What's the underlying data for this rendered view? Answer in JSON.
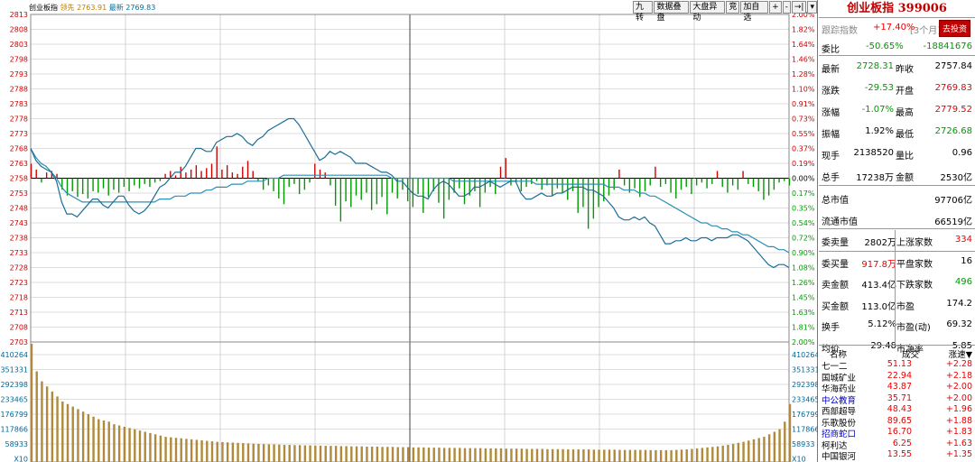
{
  "chart_info": {
    "name": "创业板指",
    "lead_label": "领先",
    "lead_value": "2763.91",
    "latest_label": "最新",
    "latest_value": "2769.83"
  },
  "toolbar": [
    "九转",
    "数据叠盘",
    "大盘异动",
    "竞",
    "加自选",
    "+",
    "-",
    "→|",
    "▾"
  ],
  "price_axis": [
    "2813",
    "2808",
    "2803",
    "2798",
    "2793",
    "2788",
    "2783",
    "2778",
    "2773",
    "2768",
    "2763",
    "2758",
    "2753",
    "2748",
    "2743",
    "2738",
    "2733",
    "2728",
    "2723",
    "2718",
    "2713",
    "2708",
    "2703"
  ],
  "pct_axis": [
    "2.00%",
    "1.82%",
    "1.64%",
    "1.46%",
    "1.28%",
    "1.10%",
    "0.91%",
    "0.73%",
    "0.55%",
    "0.37%",
    "0.19%",
    "0.00%",
    "0.17%",
    "0.35%",
    "0.54%",
    "0.72%",
    "0.90%",
    "1.08%",
    "1.26%",
    "1.45%",
    "1.63%",
    "1.81%",
    "2.00%"
  ],
  "volume_axis": [
    "410264",
    "351331",
    "292398",
    "233465",
    "176799",
    "117866",
    "58933",
    "X10"
  ],
  "chart_data": {
    "type": "line",
    "price_ylim": [
      2703,
      2813
    ],
    "prev_close": 2758,
    "volume_ylim": [
      0,
      469197
    ],
    "price_series": [
      2768,
      2764,
      2762,
      2761,
      2760,
      2757,
      2750,
      2746,
      2746,
      2745,
      2747,
      2749,
      2751,
      2751,
      2749,
      2748,
      2750,
      2752,
      2752,
      2749,
      2747,
      2746,
      2747,
      2749,
      2752,
      2755,
      2756,
      2758,
      2760,
      2760,
      2762,
      2765,
      2768,
      2768,
      2767,
      2767,
      2770,
      2771,
      2772,
      2772,
      2773,
      2772,
      2770,
      2769,
      2771,
      2772,
      2774,
      2775,
      2776,
      2777,
      2778,
      2778,
      2776,
      2773,
      2770,
      2767,
      2764,
      2765,
      2767,
      2766,
      2767,
      2766,
      2765,
      2763,
      2763,
      2763,
      2762,
      2761,
      2760,
      2760,
      2759,
      2757,
      2757,
      2755,
      2753,
      2752,
      2752,
      2751,
      2754,
      2756,
      2757,
      2756,
      2754,
      2752,
      2752,
      2753,
      2755,
      2755,
      2756,
      2757,
      2756,
      2755,
      2756,
      2757,
      2757,
      2753,
      2751,
      2751,
      2752,
      2753,
      2752,
      2752,
      2753,
      2753,
      2754,
      2755,
      2755,
      2755,
      2754,
      2754,
      2753,
      2752,
      2750,
      2748,
      2745,
      2744,
      2744,
      2745,
      2744,
      2745,
      2743,
      2742,
      2739,
      2736,
      2736,
      2737,
      2737,
      2738,
      2737,
      2737,
      2738,
      2738,
      2737,
      2738,
      2738,
      2738,
      2739,
      2739,
      2738,
      2737,
      2735,
      2733,
      2731,
      2729,
      2728,
      2729,
      2729,
      2728
    ],
    "avg_series": [
      2768,
      2765,
      2763,
      2762,
      2760,
      2758,
      2755,
      2753,
      2752,
      2751,
      2750,
      2750,
      2750,
      2750,
      2750,
      2750,
      2750,
      2750,
      2750,
      2750,
      2750,
      2750,
      2750,
      2750,
      2750,
      2751,
      2751,
      2751,
      2752,
      2752,
      2752,
      2753,
      2753,
      2753,
      2754,
      2754,
      2755,
      2755,
      2755,
      2756,
      2756,
      2756,
      2757,
      2757,
      2757,
      2757,
      2758,
      2758,
      2758,
      2759,
      2759,
      2759,
      2759,
      2759,
      2759,
      2759,
      2759,
      2759,
      2759,
      2759,
      2759,
      2759,
      2759,
      2759,
      2759,
      2759,
      2759,
      2759,
      2759,
      2759,
      2758,
      2758,
      2758,
      2758,
      2758,
      2758,
      2758,
      2758,
      2758,
      2758,
      2758,
      2758,
      2757,
      2757,
      2757,
      2757,
      2757,
      2757,
      2757,
      2757,
      2757,
      2757,
      2757,
      2757,
      2757,
      2757,
      2757,
      2757,
      2756,
      2756,
      2756,
      2756,
      2756,
      2756,
      2756,
      2756,
      2756,
      2756,
      2756,
      2756,
      2756,
      2756,
      2755,
      2755,
      2755,
      2754,
      2754,
      2754,
      2753,
      2753,
      2752,
      2752,
      2751,
      2750,
      2749,
      2748,
      2747,
      2746,
      2745,
      2744,
      2743,
      2743,
      2742,
      2742,
      2741,
      2741,
      2740,
      2740,
      2739,
      2739,
      2738,
      2737,
      2736,
      2735,
      2735,
      2734,
      2734,
      2733
    ],
    "volume_series": [
      469197,
      360000,
      320000,
      300000,
      280000,
      260000,
      240000,
      230000,
      220000,
      210000,
      200000,
      190000,
      180000,
      170000,
      165000,
      160000,
      150000,
      145000,
      140000,
      135000,
      130000,
      125000,
      120000,
      115000,
      110000,
      105000,
      100000,
      98000,
      96000,
      94000,
      92000,
      90000,
      88000,
      86000,
      84000,
      82000,
      80000,
      79000,
      78000,
      77000,
      76000,
      75000,
      74000,
      73000,
      72000,
      71000,
      70000,
      70000,
      69000,
      68000,
      68000,
      67000,
      67000,
      66000,
      66000,
      65000,
      65000,
      64000,
      64000,
      64000,
      63000,
      63000,
      62000,
      62000,
      62000,
      61000,
      61000,
      61000,
      60000,
      60000,
      60000,
      59000,
      59000,
      59000,
      58000,
      58000,
      58000,
      57000,
      57000,
      57000,
      56000,
      56000,
      56000,
      56000,
      55000,
      55000,
      55000,
      55000,
      54000,
      54000,
      54000,
      54000,
      53000,
      53000,
      53000,
      53000,
      52000,
      52000,
      52000,
      52000,
      51000,
      51000,
      51000,
      51000,
      50000,
      50000,
      50000,
      50000,
      50000,
      49000,
      49000,
      49000,
      49000,
      49000,
      48000,
      48000,
      48000,
      48000,
      48000,
      48000,
      47000,
      47000,
      47000,
      47000,
      47000,
      48000,
      49000,
      50000,
      52000,
      54000,
      56000,
      58000,
      60000,
      62000,
      65000,
      68000,
      72000,
      76000,
      80000,
      85000,
      90000,
      95000,
      100000,
      110000,
      120000,
      130000,
      160000,
      230000
    ],
    "flow_bars": [
      1.0,
      0.6,
      -0.3,
      0.4,
      0.5,
      0.3,
      -0.8,
      -1.2,
      -0.9,
      -1.3,
      -1.1,
      -1.4,
      -0.9,
      -1.0,
      -0.7,
      -1.2,
      -0.8,
      -1.0,
      -0.6,
      -0.9,
      -0.5,
      -0.7,
      -0.4,
      -0.6,
      -0.3,
      -0.2,
      0.3,
      0.5,
      0.2,
      0.8,
      0.4,
      0.6,
      0.9,
      0.5,
      0.7,
      1.0,
      2.2,
      0.6,
      0.9,
      0.4,
      0.3,
      0.8,
      1.2,
      0.5,
      -0.2,
      -0.8,
      -0.5,
      -0.9,
      -1.4,
      -1.8,
      -0.6,
      -0.4,
      -1.1,
      -0.8,
      -0.3,
      1.0,
      0.6,
      0.4,
      -0.5,
      -1.9,
      -3.0,
      -1.6,
      -2.0,
      -1.2,
      -1.5,
      -1.0,
      -2.2,
      -1.8,
      -1.3,
      -2.5,
      -1.0,
      -1.4,
      -0.8,
      -1.6,
      -2.0,
      -1.1,
      -2.4,
      -1.3,
      -0.9,
      -1.7,
      -2.8,
      -1.5,
      -1.0,
      -0.7,
      -1.8,
      -1.2,
      -0.9,
      -2.0,
      -1.0,
      -0.6,
      -1.1,
      0.8,
      1.4,
      -0.5,
      -0.3,
      -0.9,
      -0.6,
      -0.4,
      -0.2,
      -0.8,
      -0.5,
      -1.2,
      -0.7,
      -1.0,
      -1.5,
      -0.9,
      -2.4,
      -2.0,
      -3.5,
      -2.8,
      -2.0,
      -1.6,
      -1.2,
      -0.8,
      0.6,
      -0.5,
      -1.0,
      -0.7,
      -1.3,
      -0.9,
      -0.5,
      0.8,
      -0.6,
      -0.4,
      -1.0,
      -1.4,
      -0.8,
      -0.6,
      -1.1,
      -0.5,
      -0.3,
      -0.7,
      -0.4,
      0.5,
      -0.6,
      -1.0,
      -0.5,
      -0.8,
      0.5,
      -0.4,
      -0.6,
      -0.9,
      -1.5,
      -1.2,
      -0.8,
      -0.3,
      -0.2,
      -0.5
    ],
    "prev_close_pct": "0.00%"
  },
  "panel": {
    "title": "创业板指 399006",
    "track_label": "跟踪指数",
    "track_value": "+17.40%",
    "track_period": "[3个月]",
    "invest_button": "去投资",
    "rows": [
      {
        "l1": "委比",
        "v1": "-50.65%",
        "c1": "grn",
        "l2": "",
        "v2": "-18841676",
        "c2": "grn"
      },
      {
        "l1": "最新",
        "v1": "2728.31",
        "c1": "grn",
        "l2": "昨收",
        "v2": "2757.84",
        "c2": ""
      },
      {
        "l1": "涨跌",
        "v1": "-29.53",
        "c1": "grn",
        "l2": "开盘",
        "v2": "2769.83",
        "c2": "red"
      },
      {
        "l1": "涨幅",
        "v1": "-1.07%",
        "c1": "grn",
        "l2": "最高",
        "v2": "2779.52",
        "c2": "red"
      },
      {
        "l1": "振幅",
        "v1": "1.92%",
        "c1": "",
        "l2": "最低",
        "v2": "2726.68",
        "c2": "grn"
      },
      {
        "l1": "现手",
        "v1": "2138520",
        "c1": "",
        "l2": "量比",
        "v2": "0.96",
        "c2": ""
      },
      {
        "l1": "总手",
        "v1": "17238万",
        "c1": "",
        "l2": "金额",
        "v2": "2530亿",
        "c2": ""
      }
    ],
    "market_cap": [
      {
        "label": "总市值",
        "value": "97706亿"
      },
      {
        "label": "流通市值",
        "value": "66519亿"
      }
    ],
    "stats": [
      {
        "l1": "委卖量",
        "v1": "2802万",
        "c1": "",
        "l2": "上涨家数",
        "v2": "334",
        "c2": "red"
      },
      {
        "l1": "委买量",
        "v1": "917.8万",
        "c1": "red",
        "l2": "平盘家数",
        "v2": "16",
        "c2": ""
      },
      {
        "l1": "卖金额",
        "v1": "413.4亿",
        "c1": "",
        "l2": "下跌家数",
        "v2": "496",
        "c2": "grn"
      },
      {
        "l1": "买金额",
        "v1": "113.0亿",
        "c1": "",
        "l2": "市盈",
        "v2": "174.2",
        "c2": ""
      },
      {
        "l1": "换手",
        "v1": "5.12%",
        "c1": "",
        "l2": "市盈(动)",
        "v2": "69.32",
        "c2": ""
      },
      {
        "l1": "均价",
        "v1": "29.48",
        "c1": "",
        "l2": "市净率",
        "v2": "5.85",
        "c2": ""
      }
    ],
    "list_header": {
      "name": "名称",
      "deal": "成交",
      "change": "涨速"
    },
    "stocks": [
      {
        "name": "七一二",
        "price": "51.13",
        "chg": "+2.28",
        "blue": false
      },
      {
        "name": "国城矿业",
        "price": "22.94",
        "chg": "+2.18",
        "blue": false
      },
      {
        "name": "华海药业",
        "price": "43.87",
        "chg": "+2.00",
        "blue": false
      },
      {
        "name": "中公教育",
        "price": "35.71",
        "chg": "+2.00",
        "blue": true
      },
      {
        "name": "西部超导",
        "price": "48.43",
        "chg": "+1.96",
        "blue": false
      },
      {
        "name": "乐歌股份",
        "price": "89.65",
        "chg": "+1.88",
        "blue": false
      },
      {
        "name": "招商蛇口",
        "price": "16.70",
        "chg": "+1.83",
        "blue": true
      },
      {
        "name": "柯利达",
        "price": "6.25",
        "chg": "+1.63",
        "blue": false
      },
      {
        "name": "中国银河",
        "price": "13.55",
        "chg": "+1.35",
        "blue": false
      }
    ]
  },
  "colors": {
    "price_line": "#1b6e96",
    "avg_line": "#2a8fb5",
    "up": "#d00000",
    "down": "#009900",
    "volume": "#b08a3a",
    "grid": "#bbbbbb",
    "title_red": "#c00000"
  }
}
